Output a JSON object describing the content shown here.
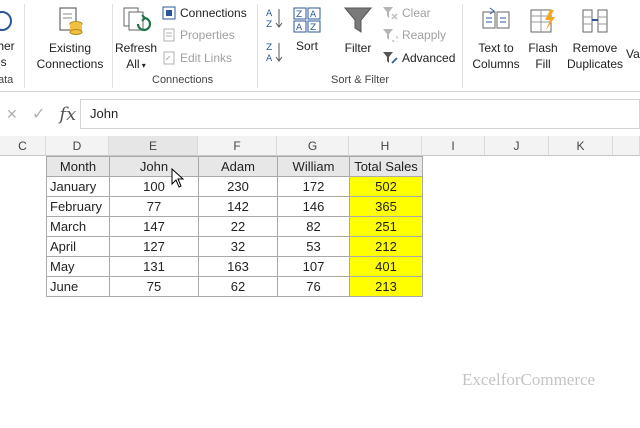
{
  "ribbon": {
    "get_data_partial": "ther",
    "get_data_partial2": "es",
    "existing_connections": [
      "Existing",
      "Connections"
    ],
    "refresh_all": [
      "Refresh",
      "All"
    ],
    "connections": "Connections",
    "properties": "Properties",
    "edit_links": "Edit Links",
    "group_connections": "Connections",
    "group_data_partial": "ata",
    "sort": "Sort",
    "filter": "Filter",
    "clear": "Clear",
    "reapply": "Reapply",
    "advanced": "Advanced",
    "group_sort_filter": "Sort & Filter",
    "text_to_columns": [
      "Text to",
      "Columns"
    ],
    "flash_fill": [
      "Flash",
      "Fill"
    ],
    "remove_duplicates": [
      "Remove",
      "Duplicates"
    ],
    "data_validation_partial": "Va"
  },
  "formula_bar": {
    "fx": "fx",
    "value": "John"
  },
  "columns": [
    "C",
    "D",
    "E",
    "F",
    "G",
    "H",
    "I",
    "J",
    "K"
  ],
  "table": {
    "headers": [
      "Month",
      "John",
      "Adam",
      "William",
      "Total Sales"
    ],
    "rows": [
      [
        "January",
        "100",
        "230",
        "172",
        "502"
      ],
      [
        "February",
        "77",
        "142",
        "146",
        "365"
      ],
      [
        "March",
        "147",
        "22",
        "82",
        "251"
      ],
      [
        "April",
        "127",
        "32",
        "53",
        "212"
      ],
      [
        "May",
        "131",
        "163",
        "107",
        "401"
      ],
      [
        "June",
        "75",
        "62",
        "76",
        "213"
      ]
    ]
  },
  "colors": {
    "highlight": "#ffff00",
    "accent": "#217346"
  },
  "watermark": "ExcelforCommerce"
}
